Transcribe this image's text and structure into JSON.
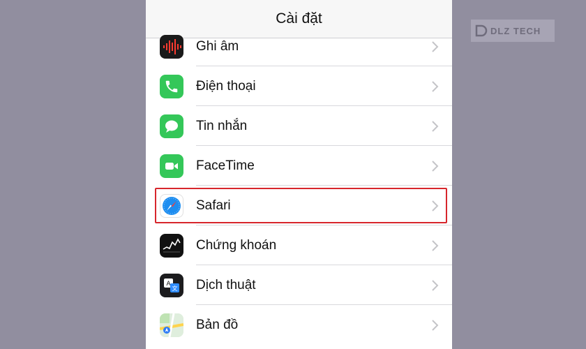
{
  "header": {
    "title": "Cài đặt"
  },
  "settings": {
    "items": [
      {
        "label": "Ghi âm",
        "icon": "voice-memos-icon"
      },
      {
        "label": "Điện thoại",
        "icon": "phone-icon"
      },
      {
        "label": "Tin nhắn",
        "icon": "messages-icon"
      },
      {
        "label": "FaceTime",
        "icon": "facetime-icon"
      },
      {
        "label": "Safari",
        "icon": "safari-icon",
        "highlighted": true
      },
      {
        "label": "Chứng khoán",
        "icon": "stocks-icon"
      },
      {
        "label": "Dịch thuật",
        "icon": "translate-icon"
      },
      {
        "label": "Bản đồ",
        "icon": "maps-icon"
      }
    ]
  },
  "watermark": {
    "text": "DLZ TECH"
  },
  "colors": {
    "background": "#918e9f",
    "highlight": "#d7262c",
    "phone_green": "#34c759",
    "safari_blue": "#1d8df0",
    "stocks_black": "#111111"
  }
}
